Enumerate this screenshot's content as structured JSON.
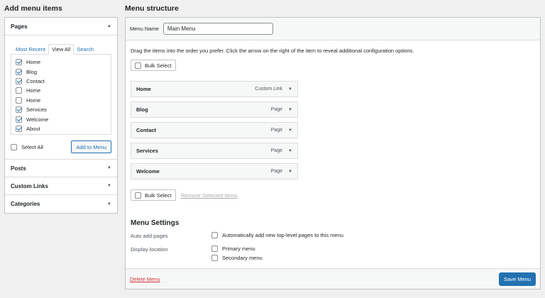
{
  "left": {
    "heading": "Add menu items",
    "pages": {
      "title": "Pages",
      "tabs": [
        "Most Recent",
        "View All",
        "Search"
      ],
      "items": [
        {
          "label": "Home",
          "checked": true
        },
        {
          "label": "Blog",
          "checked": true
        },
        {
          "label": "Contact",
          "checked": true
        },
        {
          "label": "Home",
          "checked": false
        },
        {
          "label": "Home",
          "checked": false
        },
        {
          "label": "Services",
          "checked": true
        },
        {
          "label": "Welcome",
          "checked": true
        },
        {
          "label": "About",
          "checked": true
        }
      ],
      "select_all": "Select All",
      "add_button": "Add to Menu"
    },
    "posts": "Posts",
    "custom_links": "Custom Links",
    "categories": "Categories"
  },
  "right": {
    "heading": "Menu structure",
    "menu_name_label": "Menu Name",
    "menu_name_value": "Main Menu",
    "instructions": "Drag the items into the order you prefer. Click the arrow on the right of the item to reveal additional configuration options.",
    "bulk_select": "Bulk Select",
    "items": [
      {
        "title": "Home",
        "type": "Custom Link"
      },
      {
        "title": "Blog",
        "type": "Page"
      },
      {
        "title": "Contact",
        "type": "Page"
      },
      {
        "title": "Services",
        "type": "Page"
      },
      {
        "title": "Welcome",
        "type": "Page"
      }
    ],
    "remove_selected": "Remove Selected Items",
    "settings": {
      "title": "Menu Settings",
      "auto_add_label": "Auto add pages",
      "auto_add_option": "Automatically add new top-level pages to this menu",
      "display_label": "Display location",
      "primary": "Primary menu",
      "secondary": "Secondary menu"
    },
    "delete_menu": "Delete Menu",
    "save_menu": "Save Menu"
  }
}
